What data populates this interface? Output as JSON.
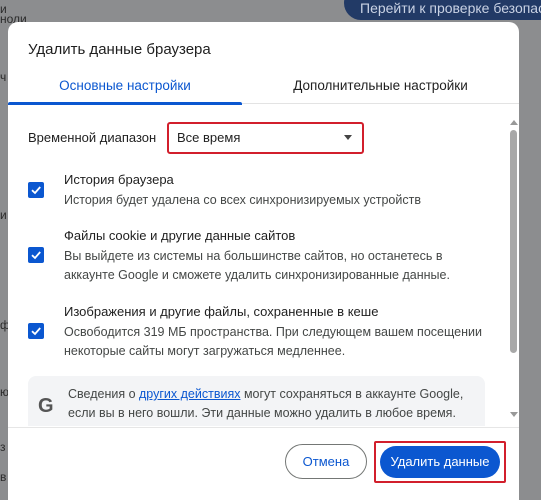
{
  "background": {
    "top_button_label": "Перейти к проверке безопасности",
    "left_snippets": [
      "и",
      "ноли",
      "ч",
      "ф",
      "и",
      "ю",
      "з",
      "в"
    ]
  },
  "dialog": {
    "title": "Удалить данные браузера",
    "tabs": [
      {
        "label": "Основные настройки",
        "active": true
      },
      {
        "label": "Дополнительные настройки",
        "active": false
      }
    ],
    "time_range": {
      "label": "Временной диапазон",
      "selected": "Все время"
    },
    "options": [
      {
        "title": "История браузера",
        "description": "История будет удалена со всех синхронизируемых устройств",
        "checked": true
      },
      {
        "title": "Файлы cookie и другие данные сайтов",
        "description": "Вы выйдете из системы на большинстве сайтов, но останетесь в аккаунте Google и сможете удалить синхронизированные данные.",
        "checked": true
      },
      {
        "title": "Изображения и другие файлы, сохраненные в кеше",
        "description": "Освободится 319 МБ пространства. При следующем вашем посещении некоторые сайты могут загружаться медленнее.",
        "checked": true
      }
    ],
    "info": {
      "prefix": "Сведения о ",
      "link": "других действиях",
      "suffix": " могут сохраняться в аккаунте Google, если вы в него вошли. Эти данные можно удалить в любое время."
    },
    "buttons": {
      "cancel": "Отмена",
      "delete": "Удалить данные"
    }
  },
  "colors": {
    "accent": "#0b57d0",
    "highlight_border": "#d21f2c"
  }
}
